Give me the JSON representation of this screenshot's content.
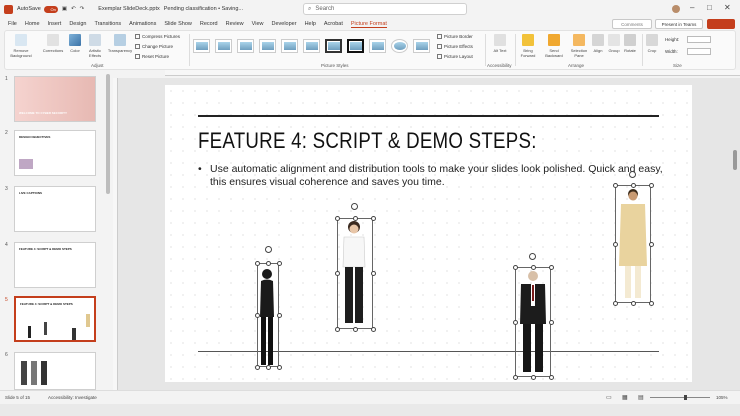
{
  "titlebar": {
    "autosave_label": "AutoSave",
    "autosave_state": "On",
    "filename": "Exemplar SlideDeck.pptx",
    "classification": "Pending classification • Saving...",
    "search_placeholder": "Search"
  },
  "tabs": [
    "File",
    "Home",
    "Insert",
    "Design",
    "Transitions",
    "Animations",
    "Slide Show",
    "Record",
    "Review",
    "View",
    "Developer",
    "Help",
    "Acrobat",
    "Picture Format"
  ],
  "active_tab": "Picture Format",
  "top_buttons": {
    "comments": "Comments",
    "present": "Present in Teams"
  },
  "ribbon": {
    "adjust": {
      "remove_bg": "Remove Background",
      "corrections": "Corrections",
      "color": "Color",
      "artistic": "Artistic Effects",
      "transparency": "Transparency",
      "compress": "Compress Pictures",
      "change": "Change Picture",
      "reset": "Reset Picture",
      "label": "Adjust"
    },
    "styles_label": "Picture Styles",
    "border": "Picture Border",
    "effects": "Picture Effects",
    "layout": "Picture Layout",
    "accessibility": {
      "alt": "Alt Text",
      "label": "Accessibility"
    },
    "arrange": {
      "forward": "Bring Forward",
      "backward": "Send Backward",
      "pane": "Selection Pane",
      "align": "Align",
      "group": "Group",
      "rotate": "Rotate",
      "label": "Arrange"
    },
    "size": {
      "crop": "Crop",
      "height": "Height:",
      "width": "Width:",
      "label": "Size"
    }
  },
  "slides_panel": [
    {
      "num": "1",
      "title": "WELCOME TO CYBER SECURITY"
    },
    {
      "num": "2",
      "title": "DESIGN OBJECTIVES"
    },
    {
      "num": "3",
      "title": "LIVE CAPTIONS"
    },
    {
      "num": "4",
      "title": "FEATURE 4: SCRIPT & DEMO STEPS"
    },
    {
      "num": "5",
      "title": "FEATURE 4: SCRIPT & DEMO STEPS"
    },
    {
      "num": "6",
      "title": ""
    }
  ],
  "slide": {
    "title": "FEATURE 4: SCRIPT & DEMO STEPS:",
    "bullet": "•",
    "body": "Use automatic alignment and distribution tools to make your slides look polished. Quick and easy, this ensures visual coherence and saves you time."
  },
  "status": {
    "slide_info": "Slide 5 of 15",
    "accessibility": "Accessibility: Investigate",
    "zoom": "105%"
  },
  "colors": {
    "accent": "#c43e1c"
  }
}
